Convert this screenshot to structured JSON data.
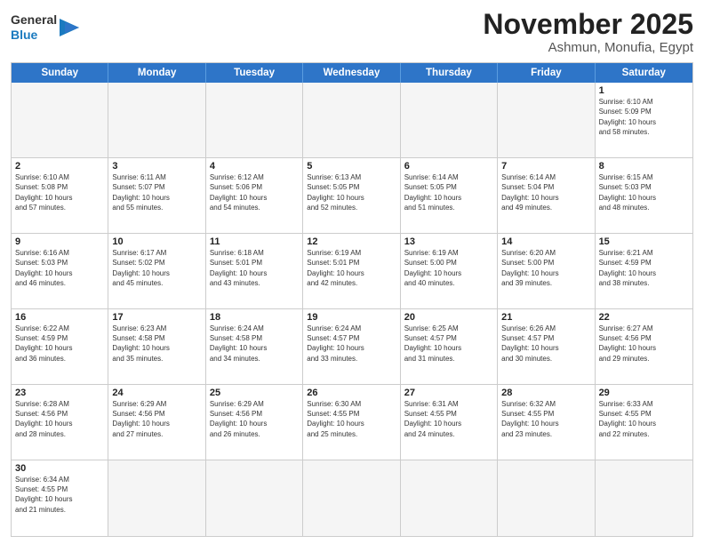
{
  "header": {
    "logo_general": "General",
    "logo_blue": "Blue",
    "month": "November 2025",
    "location": "Ashmun, Monufia, Egypt"
  },
  "weekdays": [
    "Sunday",
    "Monday",
    "Tuesday",
    "Wednesday",
    "Thursday",
    "Friday",
    "Saturday"
  ],
  "rows": [
    [
      {
        "day": "",
        "text": ""
      },
      {
        "day": "",
        "text": ""
      },
      {
        "day": "",
        "text": ""
      },
      {
        "day": "",
        "text": ""
      },
      {
        "day": "",
        "text": ""
      },
      {
        "day": "",
        "text": ""
      },
      {
        "day": "1",
        "text": "Sunrise: 6:10 AM\nSunset: 5:09 PM\nDaylight: 10 hours\nand 58 minutes."
      }
    ],
    [
      {
        "day": "2",
        "text": "Sunrise: 6:10 AM\nSunset: 5:08 PM\nDaylight: 10 hours\nand 57 minutes."
      },
      {
        "day": "3",
        "text": "Sunrise: 6:11 AM\nSunset: 5:07 PM\nDaylight: 10 hours\nand 55 minutes."
      },
      {
        "day": "4",
        "text": "Sunrise: 6:12 AM\nSunset: 5:06 PM\nDaylight: 10 hours\nand 54 minutes."
      },
      {
        "day": "5",
        "text": "Sunrise: 6:13 AM\nSunset: 5:05 PM\nDaylight: 10 hours\nand 52 minutes."
      },
      {
        "day": "6",
        "text": "Sunrise: 6:14 AM\nSunset: 5:05 PM\nDaylight: 10 hours\nand 51 minutes."
      },
      {
        "day": "7",
        "text": "Sunrise: 6:14 AM\nSunset: 5:04 PM\nDaylight: 10 hours\nand 49 minutes."
      },
      {
        "day": "8",
        "text": "Sunrise: 6:15 AM\nSunset: 5:03 PM\nDaylight: 10 hours\nand 48 minutes."
      }
    ],
    [
      {
        "day": "9",
        "text": "Sunrise: 6:16 AM\nSunset: 5:03 PM\nDaylight: 10 hours\nand 46 minutes."
      },
      {
        "day": "10",
        "text": "Sunrise: 6:17 AM\nSunset: 5:02 PM\nDaylight: 10 hours\nand 45 minutes."
      },
      {
        "day": "11",
        "text": "Sunrise: 6:18 AM\nSunset: 5:01 PM\nDaylight: 10 hours\nand 43 minutes."
      },
      {
        "day": "12",
        "text": "Sunrise: 6:19 AM\nSunset: 5:01 PM\nDaylight: 10 hours\nand 42 minutes."
      },
      {
        "day": "13",
        "text": "Sunrise: 6:19 AM\nSunset: 5:00 PM\nDaylight: 10 hours\nand 40 minutes."
      },
      {
        "day": "14",
        "text": "Sunrise: 6:20 AM\nSunset: 5:00 PM\nDaylight: 10 hours\nand 39 minutes."
      },
      {
        "day": "15",
        "text": "Sunrise: 6:21 AM\nSunset: 4:59 PM\nDaylight: 10 hours\nand 38 minutes."
      }
    ],
    [
      {
        "day": "16",
        "text": "Sunrise: 6:22 AM\nSunset: 4:59 PM\nDaylight: 10 hours\nand 36 minutes."
      },
      {
        "day": "17",
        "text": "Sunrise: 6:23 AM\nSunset: 4:58 PM\nDaylight: 10 hours\nand 35 minutes."
      },
      {
        "day": "18",
        "text": "Sunrise: 6:24 AM\nSunset: 4:58 PM\nDaylight: 10 hours\nand 34 minutes."
      },
      {
        "day": "19",
        "text": "Sunrise: 6:24 AM\nSunset: 4:57 PM\nDaylight: 10 hours\nand 33 minutes."
      },
      {
        "day": "20",
        "text": "Sunrise: 6:25 AM\nSunset: 4:57 PM\nDaylight: 10 hours\nand 31 minutes."
      },
      {
        "day": "21",
        "text": "Sunrise: 6:26 AM\nSunset: 4:57 PM\nDaylight: 10 hours\nand 30 minutes."
      },
      {
        "day": "22",
        "text": "Sunrise: 6:27 AM\nSunset: 4:56 PM\nDaylight: 10 hours\nand 29 minutes."
      }
    ],
    [
      {
        "day": "23",
        "text": "Sunrise: 6:28 AM\nSunset: 4:56 PM\nDaylight: 10 hours\nand 28 minutes."
      },
      {
        "day": "24",
        "text": "Sunrise: 6:29 AM\nSunset: 4:56 PM\nDaylight: 10 hours\nand 27 minutes."
      },
      {
        "day": "25",
        "text": "Sunrise: 6:29 AM\nSunset: 4:56 PM\nDaylight: 10 hours\nand 26 minutes."
      },
      {
        "day": "26",
        "text": "Sunrise: 6:30 AM\nSunset: 4:55 PM\nDaylight: 10 hours\nand 25 minutes."
      },
      {
        "day": "27",
        "text": "Sunrise: 6:31 AM\nSunset: 4:55 PM\nDaylight: 10 hours\nand 24 minutes."
      },
      {
        "day": "28",
        "text": "Sunrise: 6:32 AM\nSunset: 4:55 PM\nDaylight: 10 hours\nand 23 minutes."
      },
      {
        "day": "29",
        "text": "Sunrise: 6:33 AM\nSunset: 4:55 PM\nDaylight: 10 hours\nand 22 minutes."
      }
    ],
    [
      {
        "day": "30",
        "text": "Sunrise: 6:34 AM\nSunset: 4:55 PM\nDaylight: 10 hours\nand 21 minutes."
      },
      {
        "day": "",
        "text": ""
      },
      {
        "day": "",
        "text": ""
      },
      {
        "day": "",
        "text": ""
      },
      {
        "day": "",
        "text": ""
      },
      {
        "day": "",
        "text": ""
      },
      {
        "day": "",
        "text": ""
      }
    ]
  ]
}
